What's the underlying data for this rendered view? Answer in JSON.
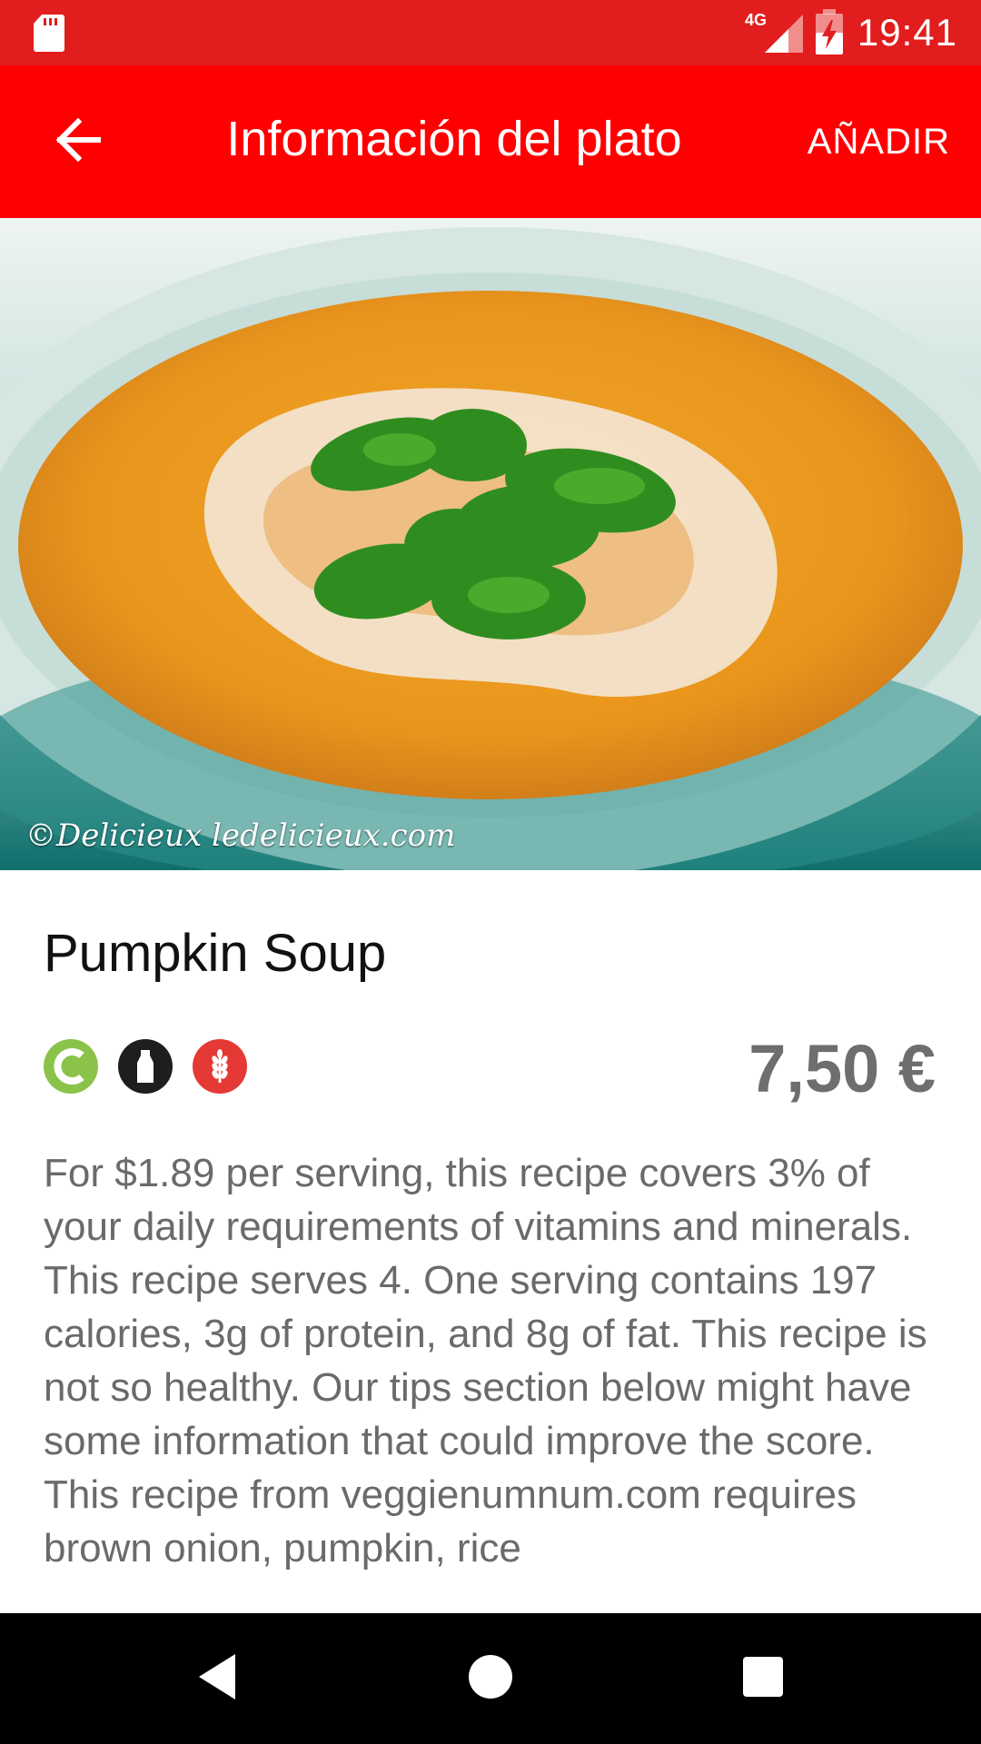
{
  "status_bar": {
    "time": "19:41",
    "network": "4G",
    "icons": [
      "sd-card-icon",
      "signal-icon",
      "battery-charging-icon"
    ]
  },
  "toolbar": {
    "title": "Información del plato",
    "action_label": "AÑADIR",
    "back_icon": "arrow-back-icon"
  },
  "dish": {
    "image_watermark": "©Delicieux ledelicieux.com",
    "name": "Pumpkin Soup",
    "price": "7,50 €",
    "badges": [
      {
        "name": "c-icon",
        "color": "#8bc34a"
      },
      {
        "name": "milk-bottle-icon",
        "color": "#1e1e1e"
      },
      {
        "name": "wheat-icon",
        "color": "#e53935"
      }
    ],
    "description": "For $1.89 per serving, this recipe covers 3% of your daily requirements of vitamins and minerals. This recipe serves 4. One serving contains 197 calories, 3g of protein, and 8g of fat. This recipe is not so healthy. Our tips section below might have some information that could improve the score. This recipe from veggienumnum.com requires brown onion, pumpkin, rice"
  },
  "colors": {
    "status_bar": "#e11d1d",
    "toolbar": "#ff0000",
    "price_text": "#6e6e6e",
    "description_text": "#6a6a6a"
  },
  "nav_bar": {
    "icons": [
      "nav-back-icon",
      "nav-home-icon",
      "nav-recents-icon"
    ]
  }
}
